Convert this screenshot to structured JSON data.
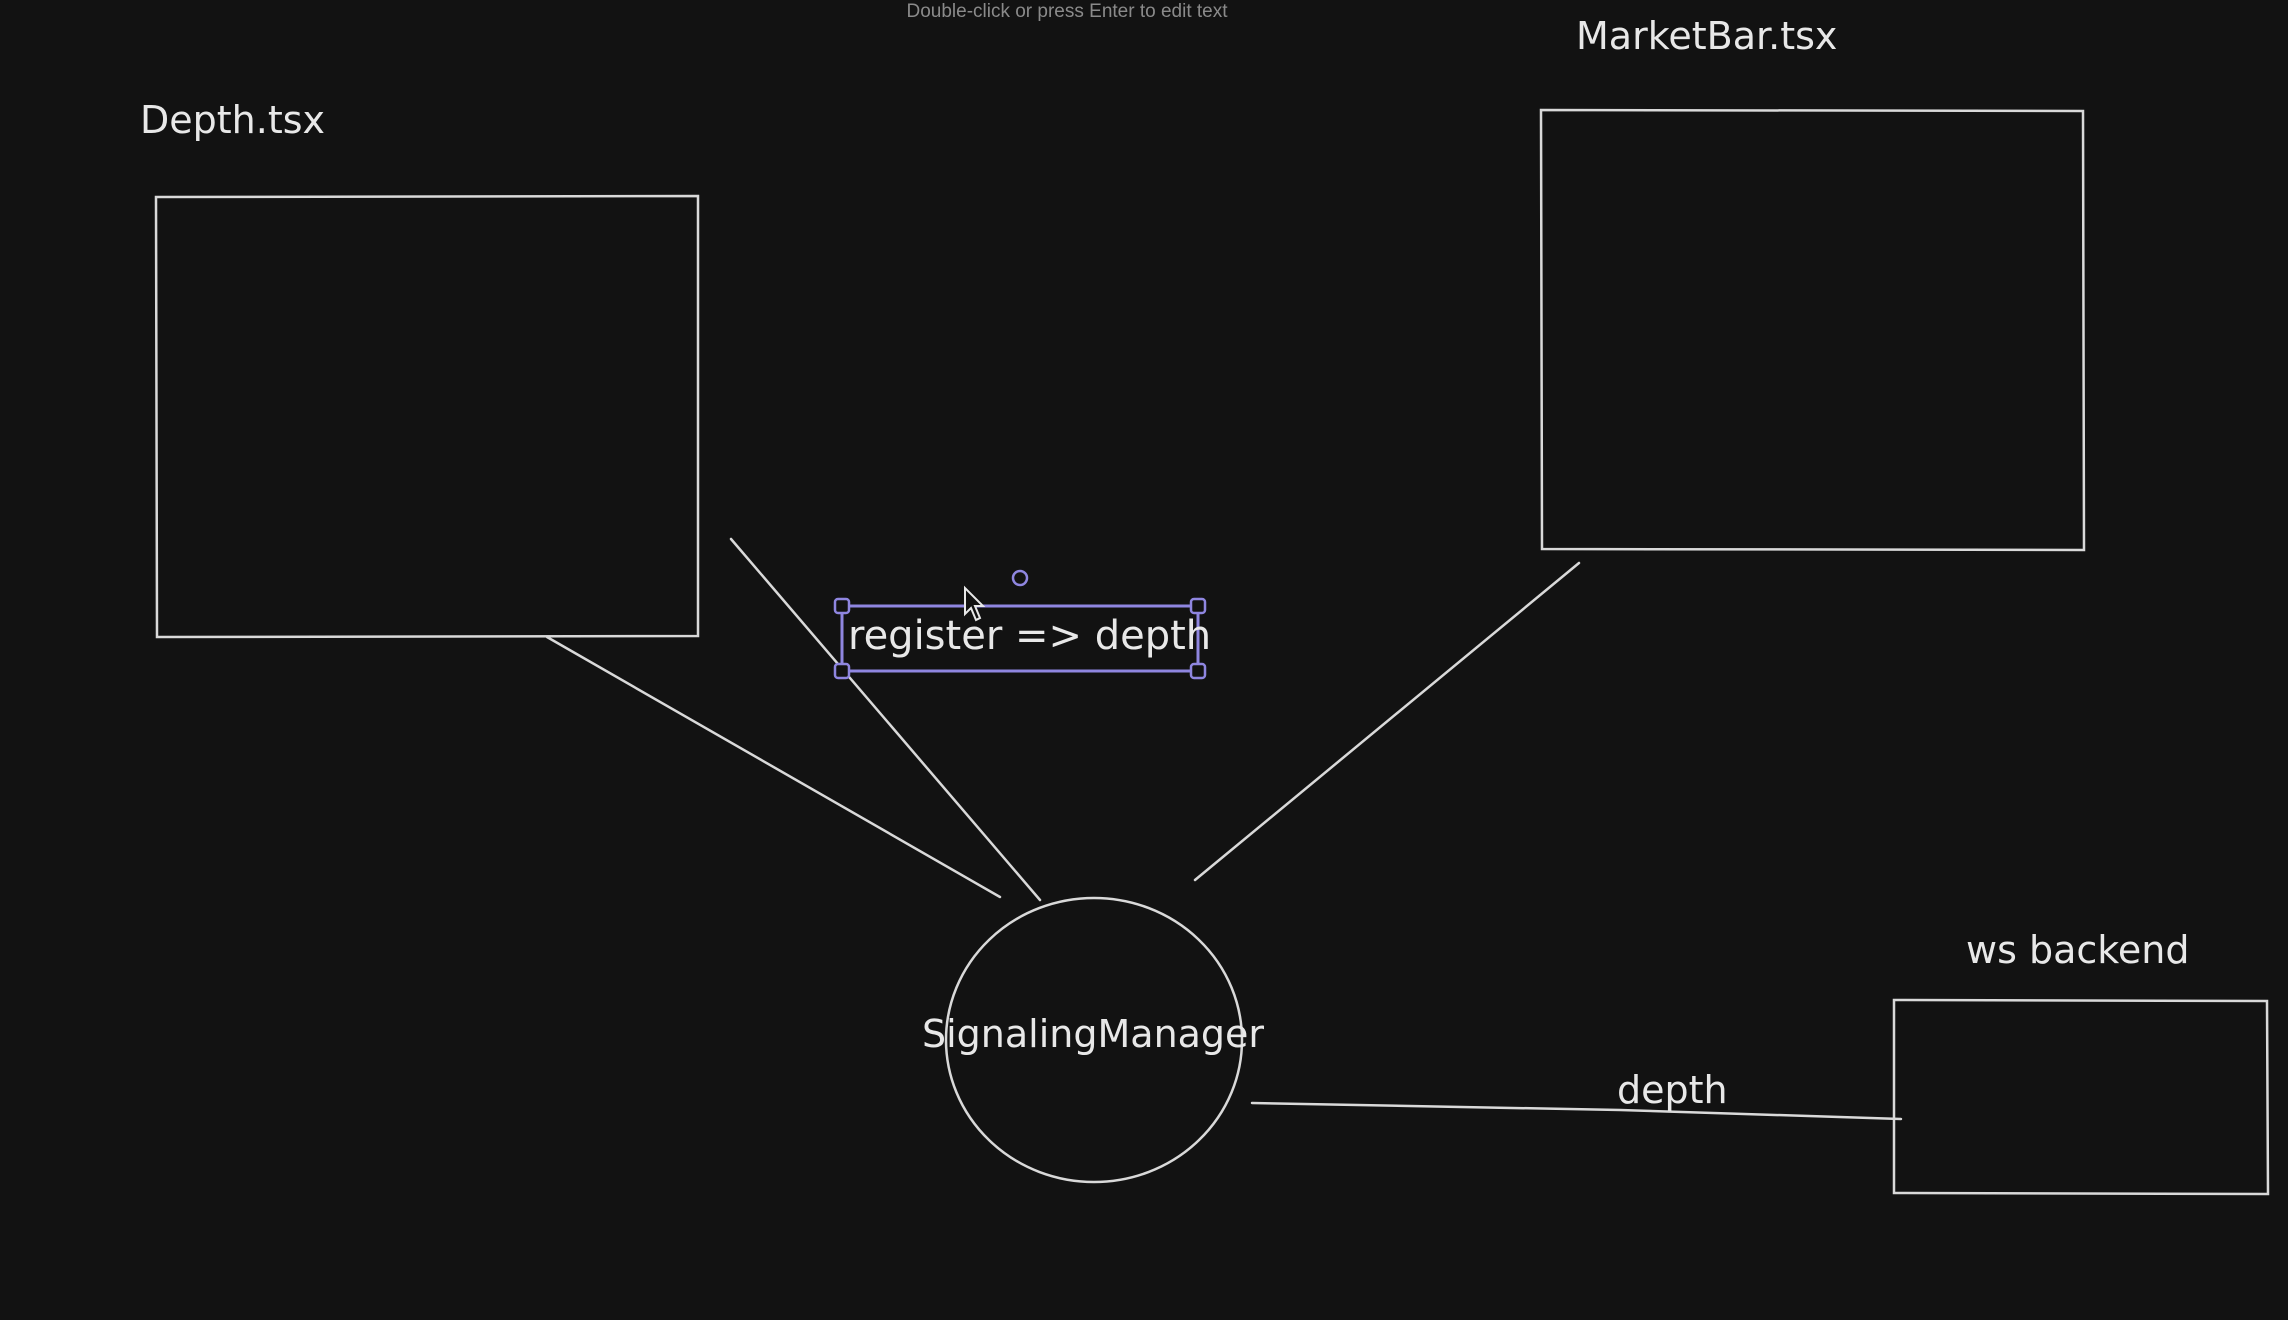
{
  "hint": "Double-click or press Enter to edit text",
  "colors": {
    "background": "#121212",
    "stroke": "#d9d9d9",
    "text": "#e8e8e8",
    "selection": "#8f86e0"
  },
  "diagram": {
    "nodes": [
      {
        "id": "depth",
        "label": "Depth.tsx",
        "shape": "rectangle"
      },
      {
        "id": "marketbar",
        "label": "MarketBar.tsx",
        "shape": "rectangle"
      },
      {
        "id": "signaling",
        "label": "SignalingManager",
        "shape": "circle"
      },
      {
        "id": "ws",
        "label": "ws backend",
        "shape": "rectangle"
      }
    ],
    "edges": [
      {
        "from": "depth",
        "to": "signaling",
        "label": ""
      },
      {
        "from": "depth",
        "to": "signaling",
        "label": "register => depth"
      },
      {
        "from": "marketbar",
        "to": "signaling",
        "label": ""
      },
      {
        "from": "signaling",
        "to": "ws",
        "label": "depth"
      }
    ],
    "selected_text": "register => depth"
  }
}
